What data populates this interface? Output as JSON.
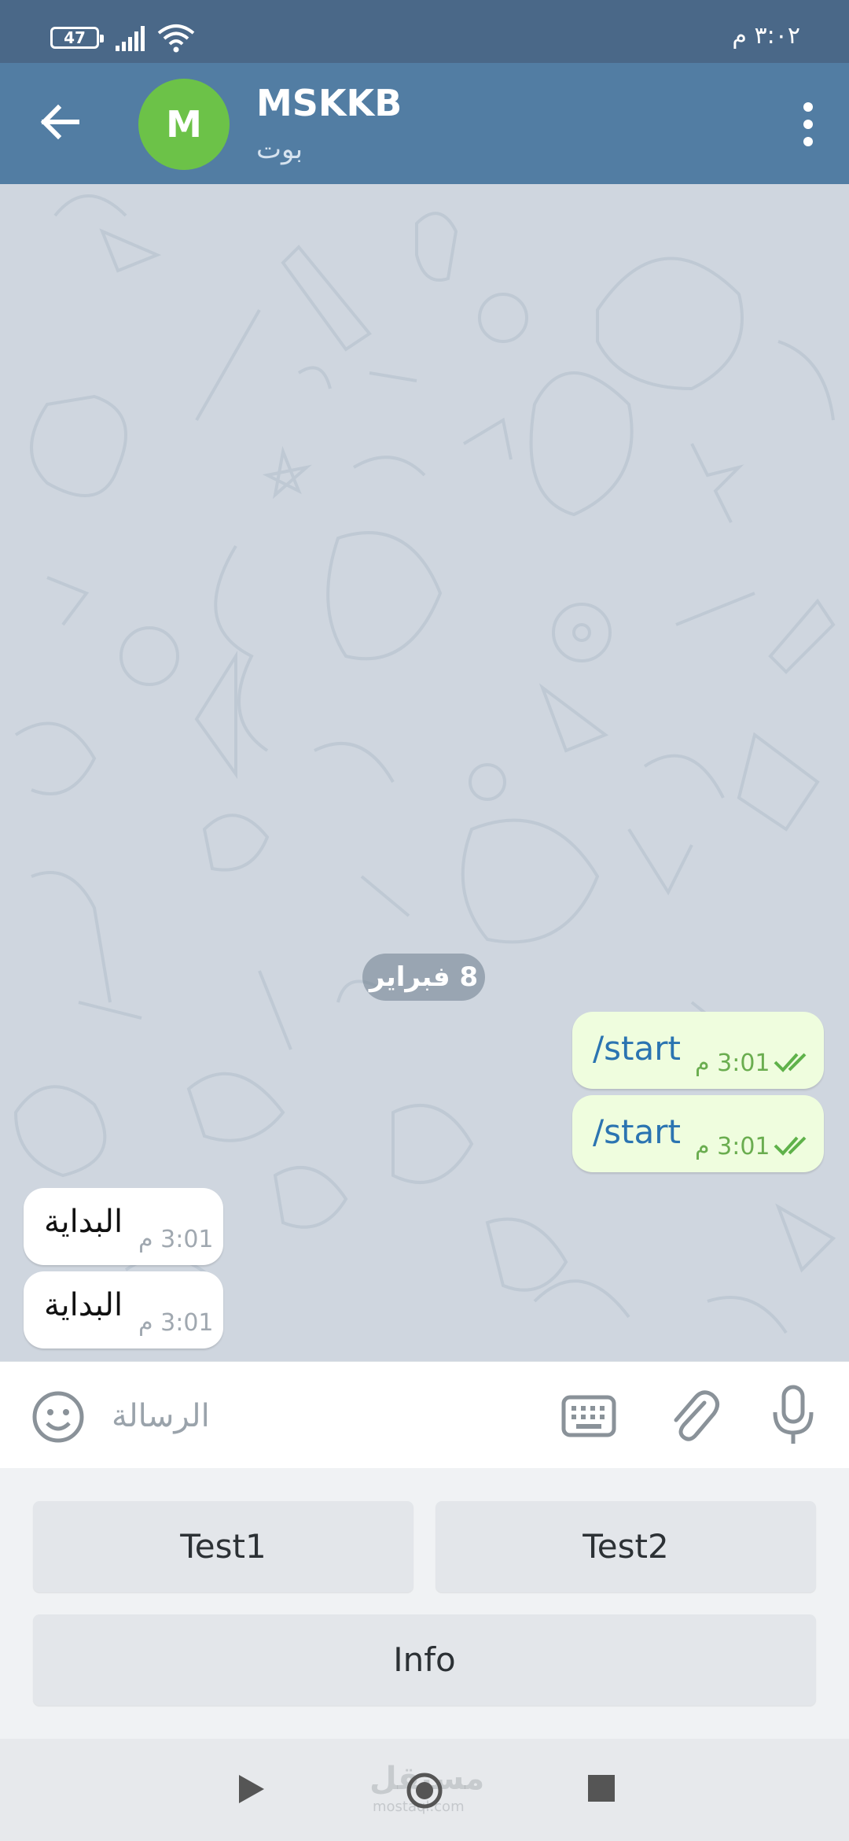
{
  "status_bar": {
    "battery": "47",
    "time": "٣:٠٢ م"
  },
  "header": {
    "avatar_letter": "M",
    "title": "MSKKB",
    "subtitle": "بوت"
  },
  "chat": {
    "date_separator": "8 فبراير",
    "messages": [
      {
        "direction": "out",
        "text": "/start",
        "time": "3:01 م",
        "status": "read"
      },
      {
        "direction": "out",
        "text": "/start",
        "time": "3:01 م",
        "status": "read"
      },
      {
        "direction": "in",
        "text": "البداية",
        "time": "3:01 م"
      },
      {
        "direction": "in",
        "text": "البداية",
        "time": "3:01 م"
      }
    ]
  },
  "composer": {
    "placeholder": "الرسالة",
    "value": ""
  },
  "bot_keyboard": {
    "buttons": [
      "Test1",
      "Test2",
      "Info"
    ]
  },
  "watermark": {
    "text": "مستقل",
    "sub": "mostaql.com"
  },
  "colors": {
    "header": "#527da3",
    "status_bar": "#4a6888",
    "outgoing_bubble": "#effdde",
    "avatar": "#6cc248",
    "link_text": "#2b74b1"
  }
}
